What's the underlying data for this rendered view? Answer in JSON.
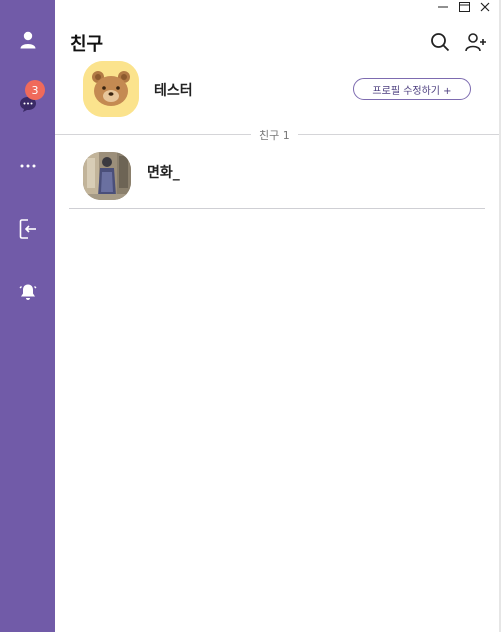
{
  "colors": {
    "sidebar": "#715ba8",
    "badge": "#f06a5b",
    "accent_border": "#7d6bb0",
    "avatar_bg": "#fbe38d"
  },
  "window_controls": [
    "minimize-icon",
    "maximize-icon",
    "close-icon"
  ],
  "sidebar": {
    "items": [
      {
        "icon": "person-icon"
      },
      {
        "icon": "chat-icon",
        "badge": "3"
      },
      {
        "icon": "more-icon"
      },
      {
        "icon": "logout-icon"
      },
      {
        "icon": "bell-icon"
      }
    ]
  },
  "header": {
    "title": "친구",
    "actions": [
      "search-icon",
      "add-friend-icon"
    ]
  },
  "my_profile": {
    "name": "테스터",
    "edit_label": "프로필 수정하기 +"
  },
  "friends_section": {
    "label": "친구 1"
  },
  "friends": [
    {
      "name": "면화_"
    }
  ]
}
